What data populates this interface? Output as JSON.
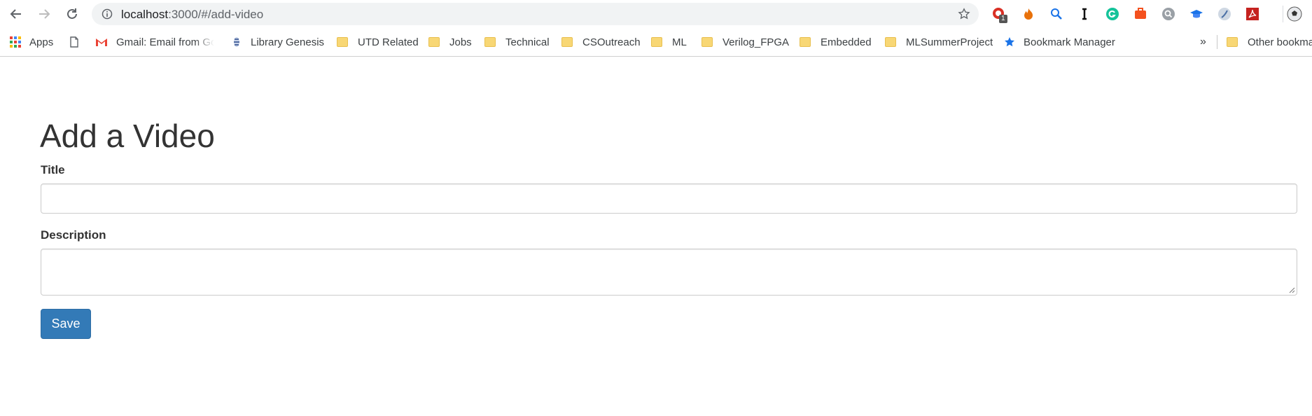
{
  "browser": {
    "url_host": "localhost",
    "url_path": ":3000/#/add-video",
    "extension_badge": "1"
  },
  "bookmarks": {
    "items": [
      {
        "label": "Apps",
        "icon": "apps-grid-icon"
      },
      {
        "label": "",
        "icon": "page-icon"
      },
      {
        "label": "Gmail: Email from Go",
        "icon": "gmail-icon"
      },
      {
        "label": "Library Genesis",
        "icon": "library-icon"
      },
      {
        "label": "UTD Related",
        "icon": "folder-icon"
      },
      {
        "label": "Jobs",
        "icon": "folder-icon"
      },
      {
        "label": "Technical",
        "icon": "folder-icon"
      },
      {
        "label": "CSOutreach",
        "icon": "folder-icon"
      },
      {
        "label": "ML",
        "icon": "folder-icon"
      },
      {
        "label": "Verilog_FPGA",
        "icon": "folder-icon"
      },
      {
        "label": "Embedded",
        "icon": "folder-icon"
      },
      {
        "label": "MLSummerProject",
        "icon": "folder-icon"
      },
      {
        "label": "Bookmark Manager",
        "icon": "star-icon"
      }
    ],
    "overflow": "»",
    "other": "Other bookma"
  },
  "form": {
    "heading": "Add a Video",
    "title_label": "Title",
    "title_value": "",
    "description_label": "Description",
    "description_value": "",
    "save_label": "Save"
  },
  "colors": {
    "primary": "#337ab7",
    "text": "#333333"
  }
}
